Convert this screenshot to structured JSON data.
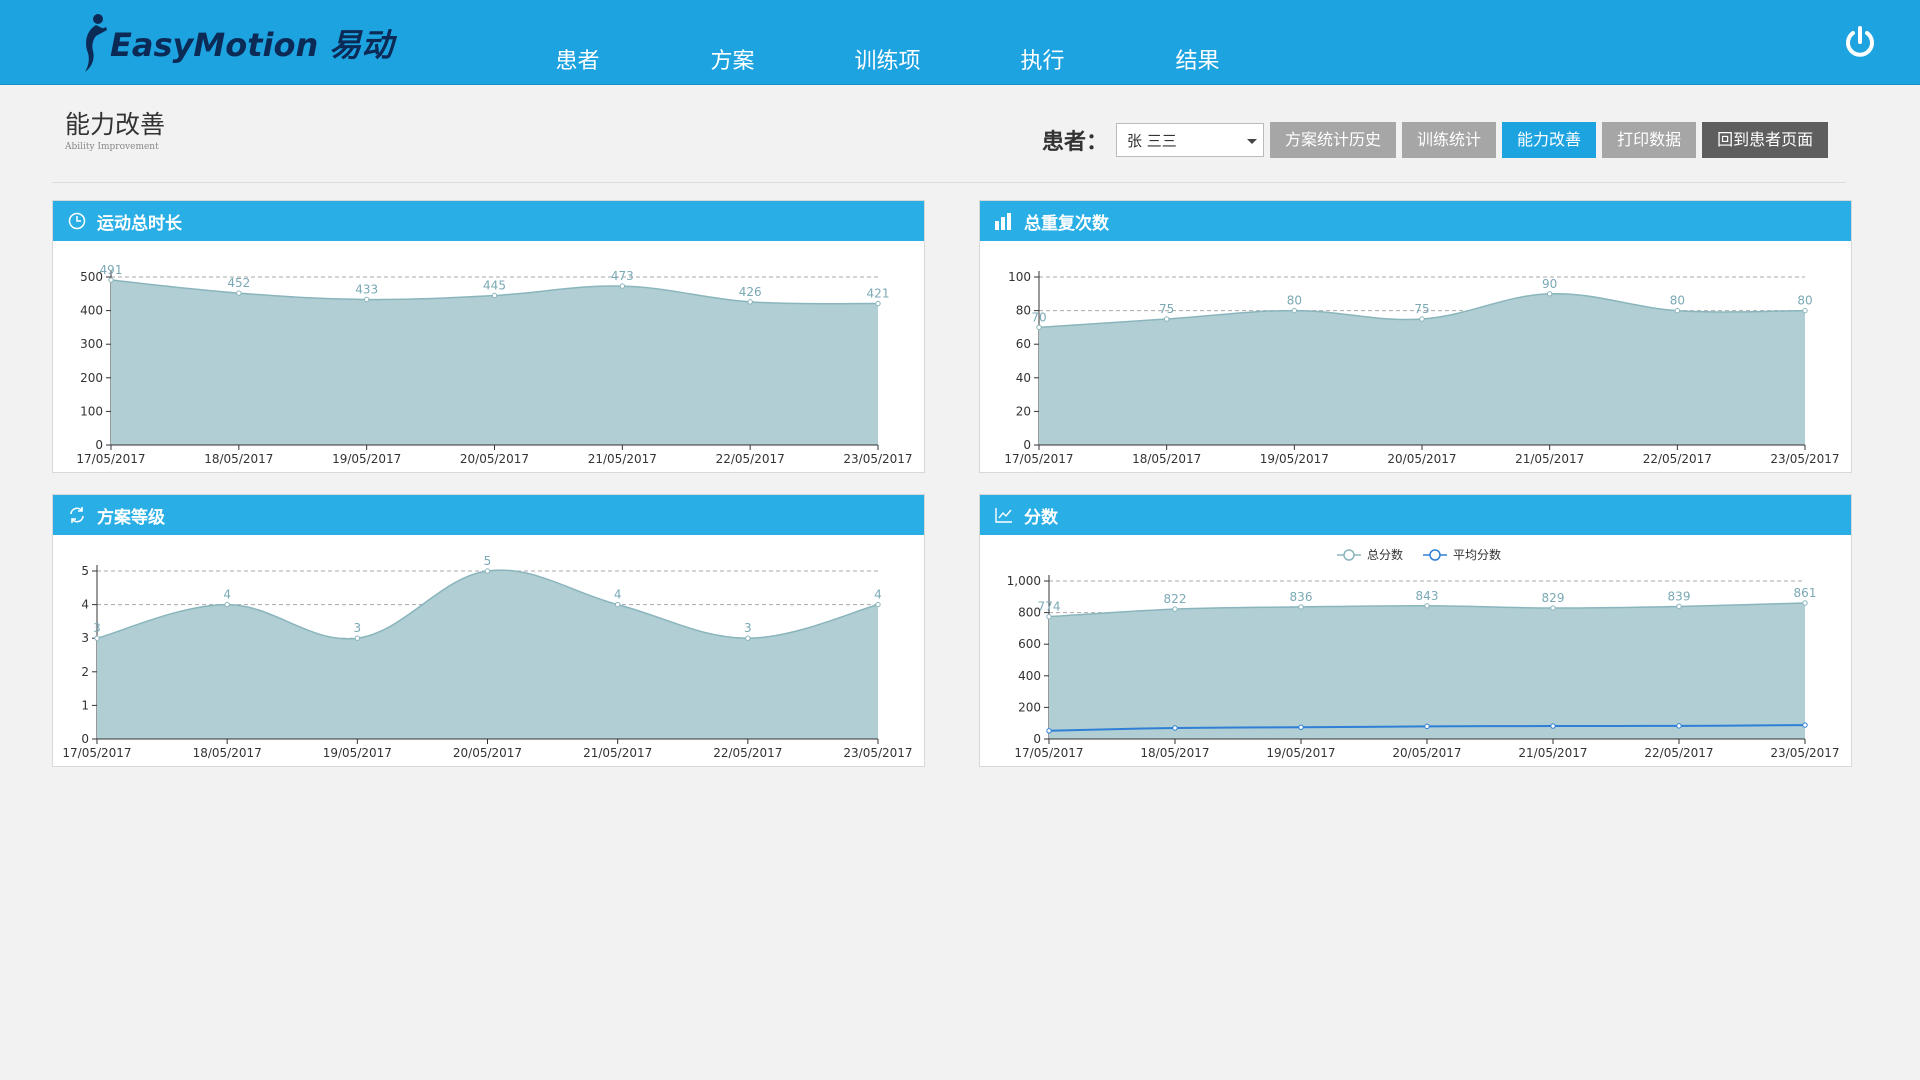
{
  "app": {
    "logo_text": "EasyMotion 易动",
    "nav": [
      "患者",
      "方案",
      "训练项",
      "执行",
      "结果"
    ]
  },
  "page": {
    "title": "能力改善",
    "subtitle": "Ability Improvement"
  },
  "toolbar": {
    "patient_label": "患者：",
    "patient_value": "张 三三",
    "buttons": [
      "方案统计历史",
      "训练统计",
      "能力改善",
      "打印数据",
      "回到患者页面"
    ],
    "active_index": 2
  },
  "colors": {
    "brand": "#1ea3e1",
    "area_fill": "#b0ced3",
    "area_line": "#8ab5bd",
    "label": "#7aa9b5",
    "avg_line": "#2f7fd6"
  },
  "chart_data": [
    {
      "type": "area",
      "title": "运动总时长",
      "icon": "clock-icon",
      "x": [
        "17/05/2017",
        "18/05/2017",
        "19/05/2017",
        "20/05/2017",
        "21/05/2017",
        "22/05/2017",
        "23/05/2017"
      ],
      "values": [
        491,
        452,
        433,
        445,
        473,
        426,
        421
      ],
      "ylim": [
        0,
        500
      ],
      "yticks": [
        0,
        100,
        200,
        300,
        400,
        500
      ],
      "grid": true
    },
    {
      "type": "area",
      "title": "总重复次数",
      "icon": "bar-chart-icon",
      "x": [
        "17/05/2017",
        "18/05/2017",
        "19/05/2017",
        "20/05/2017",
        "21/05/2017",
        "22/05/2017",
        "23/05/2017"
      ],
      "values": [
        70,
        75,
        80,
        75,
        90,
        80,
        80
      ],
      "ylim": [
        0,
        100
      ],
      "yticks": [
        0,
        20,
        40,
        60,
        80,
        100
      ],
      "grid": true
    },
    {
      "type": "area",
      "title": "方案等级",
      "icon": "refresh-icon",
      "x": [
        "17/05/2017",
        "18/05/2017",
        "19/05/2017",
        "20/05/2017",
        "21/05/2017",
        "22/05/2017",
        "23/05/2017"
      ],
      "values": [
        3,
        4,
        3,
        5,
        4,
        3,
        4
      ],
      "ylim": [
        0,
        5
      ],
      "yticks": [
        0,
        1,
        2,
        3,
        4,
        5
      ],
      "grid": true
    },
    {
      "type": "area",
      "title": "分数",
      "icon": "line-chart-icon",
      "x": [
        "17/05/2017",
        "18/05/2017",
        "19/05/2017",
        "20/05/2017",
        "21/05/2017",
        "22/05/2017",
        "23/05/2017"
      ],
      "series": [
        {
          "name": "总分数",
          "values": [
            774,
            822,
            836,
            843,
            829,
            839,
            861
          ]
        },
        {
          "name": "平均分数",
          "values": [
            52,
            70,
            74,
            80,
            82,
            83,
            88
          ]
        }
      ],
      "ylim": [
        0,
        1000
      ],
      "yticks": [
        "0",
        "200",
        "400",
        "600",
        "800",
        "1,000"
      ],
      "legend": "top-center",
      "grid": true
    }
  ]
}
